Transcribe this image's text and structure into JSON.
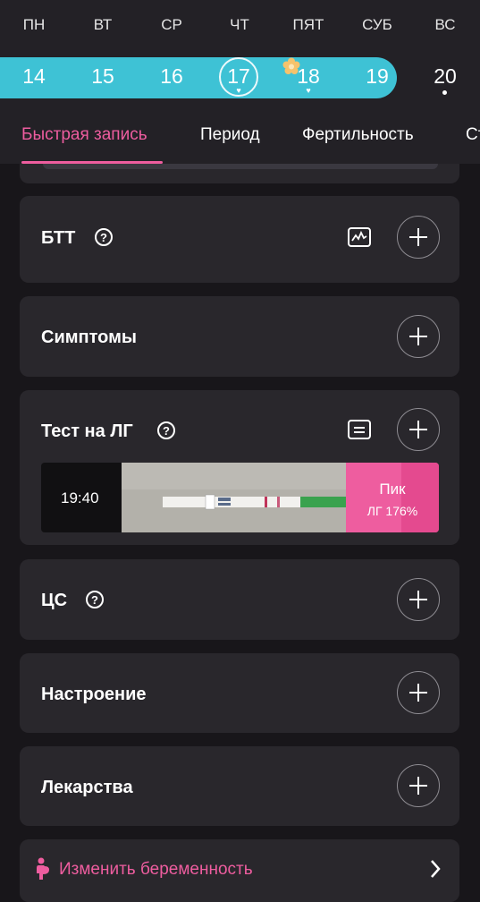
{
  "calendar": {
    "weekdays": [
      "ПН",
      "ВТ",
      "СР",
      "ЧТ",
      "ПЯТ",
      "СУБ",
      "ВС"
    ],
    "days": [
      "14",
      "15",
      "16",
      "17",
      "18",
      "19",
      "20"
    ]
  },
  "tabs": [
    "Быстрая запись",
    "Период",
    "Фертильность",
    "Ст"
  ],
  "cards": {
    "btt": {
      "title": "БТТ"
    },
    "symptoms": {
      "title": "Симптомы"
    },
    "lh_test": {
      "title": "Тест на ЛГ",
      "entry_time": "19:40",
      "badge_title": "Пик",
      "badge_value": "ЛГ 176%"
    },
    "cs": {
      "title": "ЦС"
    },
    "mood": {
      "title": "Настроение"
    },
    "meds": {
      "title": "Лекарства"
    }
  },
  "pregnancy": {
    "label": "Изменить беременность"
  },
  "colors": {
    "accent": "#ee5d9f",
    "calendar_band": "#3ec2d5",
    "background": "#18161a",
    "card": "#29272c"
  }
}
